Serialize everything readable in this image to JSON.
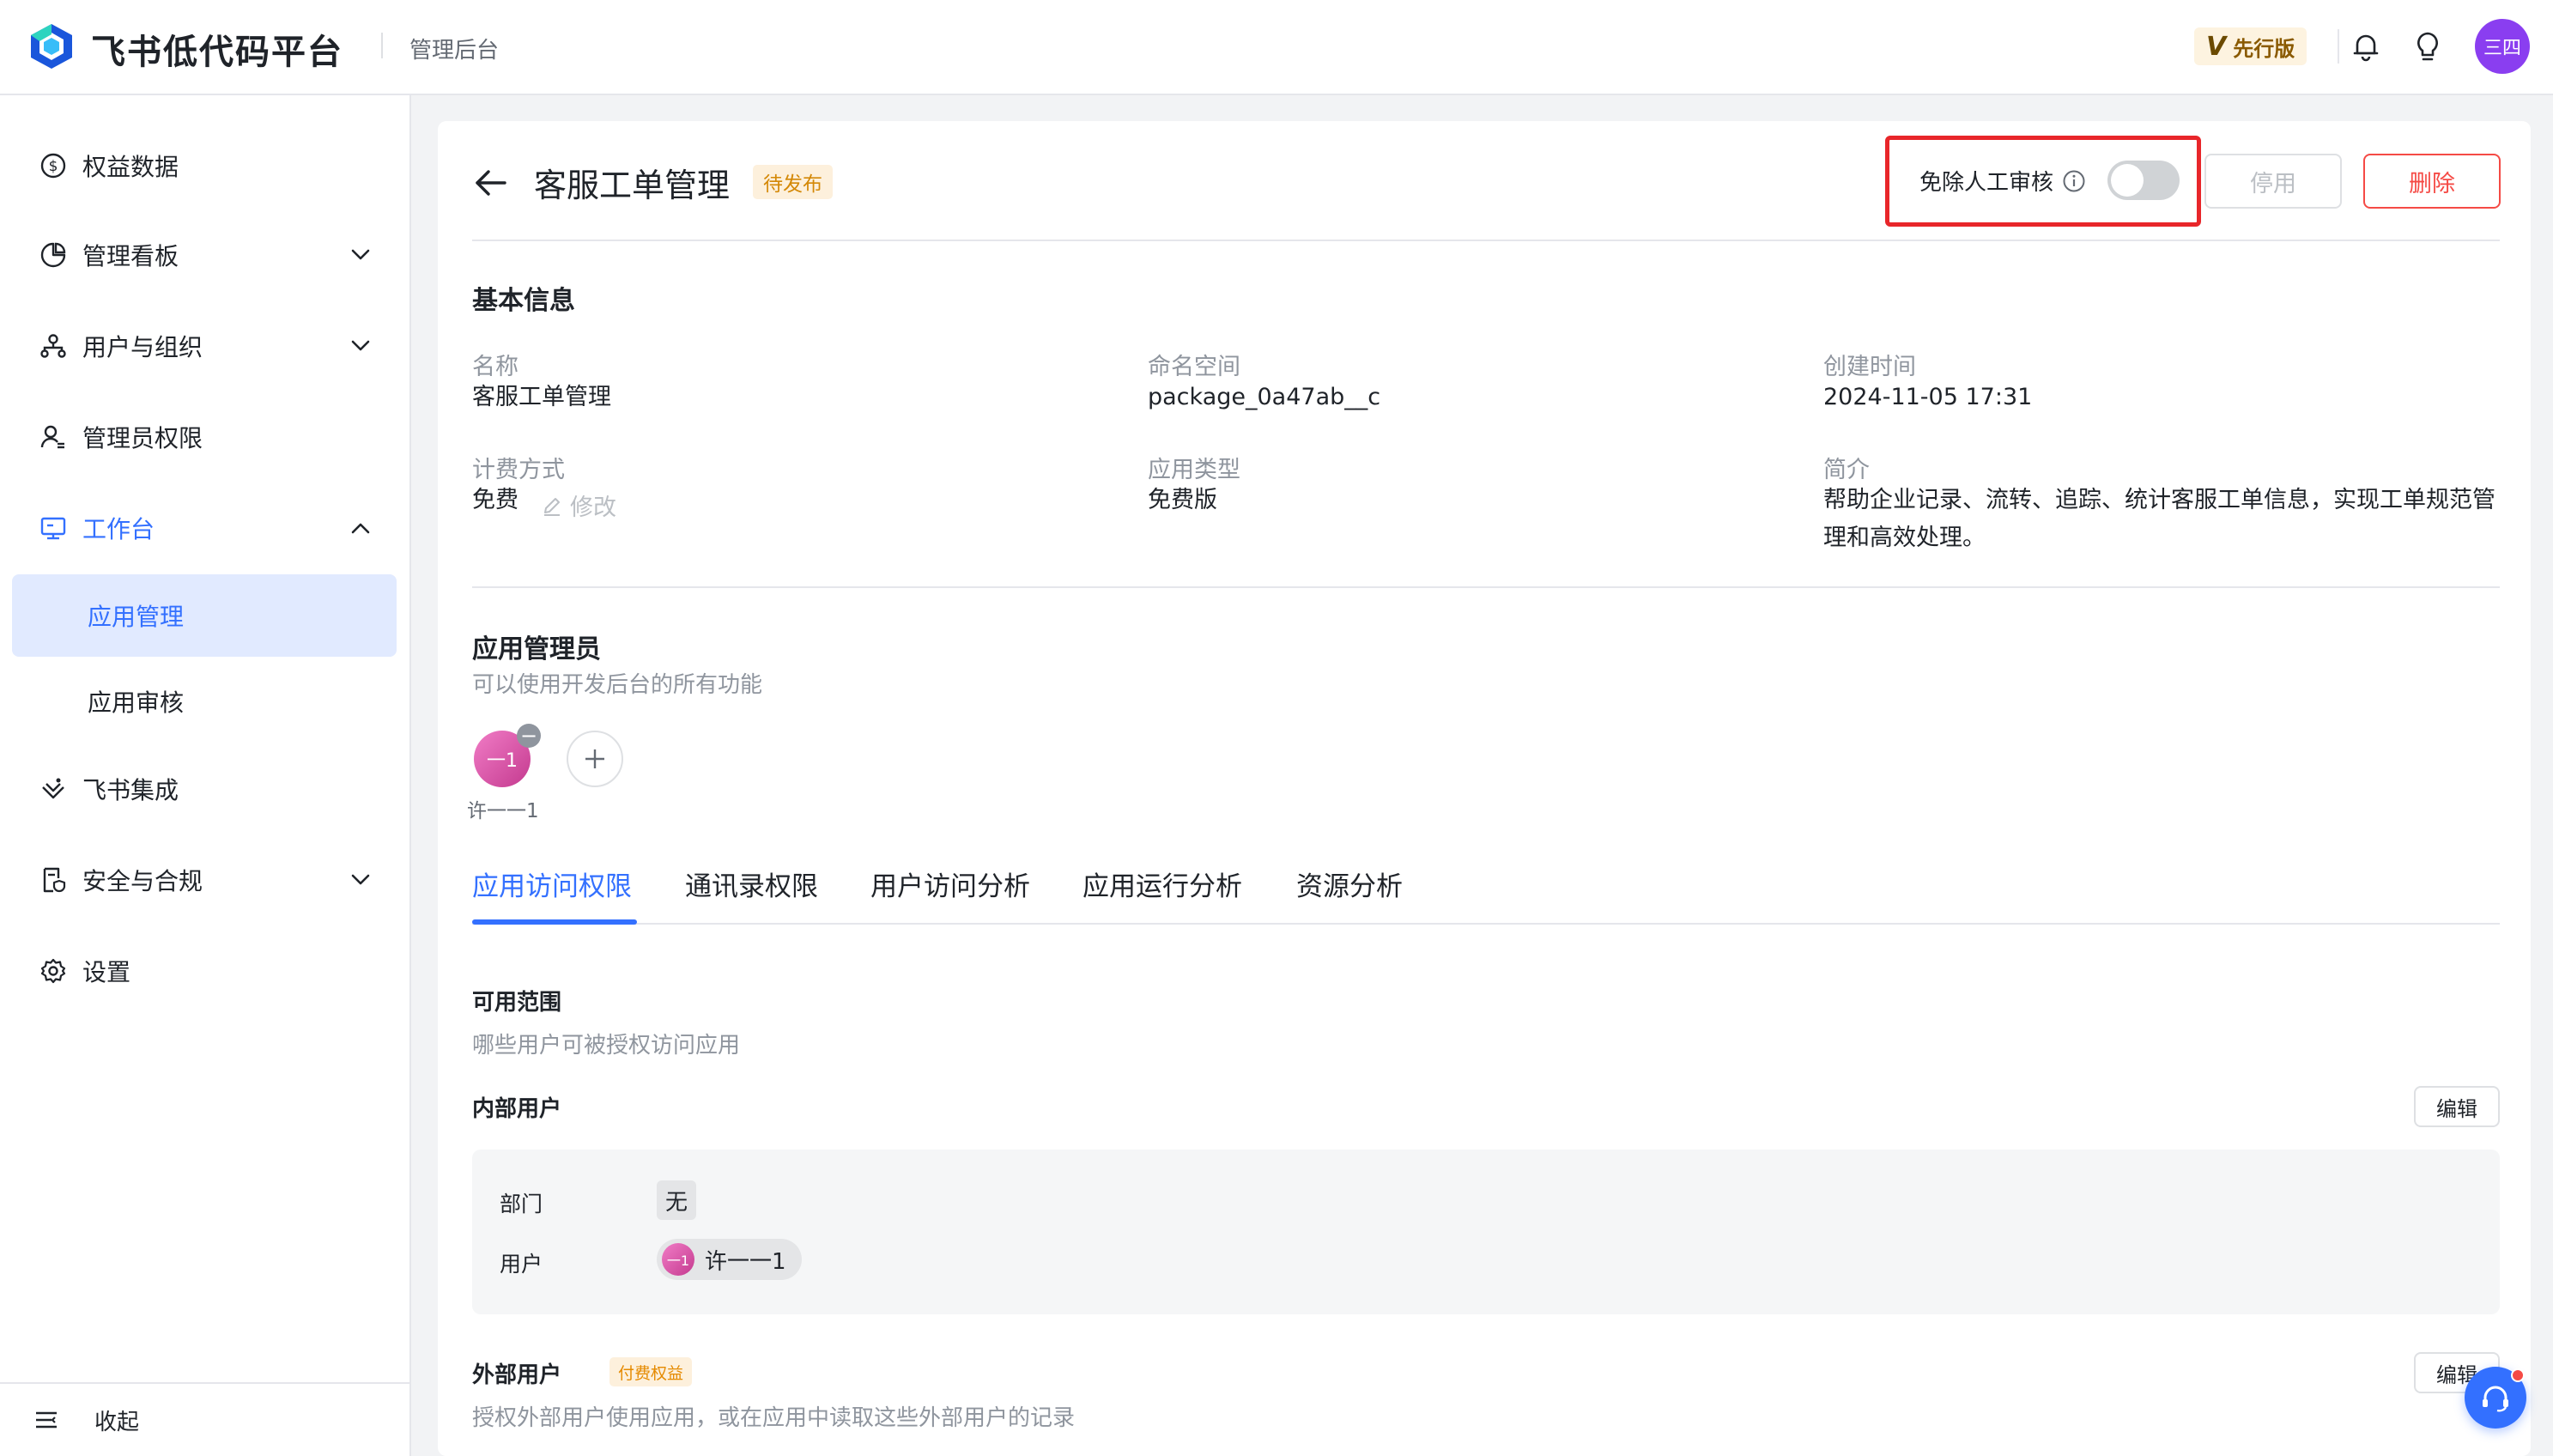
{
  "header": {
    "brand": "飞书低代码平台",
    "subtitle": "管理后台",
    "edition_badge": "先行版",
    "edition_mark": "V",
    "user_avatar": "三四"
  },
  "sidebar": {
    "items": [
      {
        "label": "权益数据",
        "icon": "dollar-circle-icon"
      },
      {
        "label": "管理看板",
        "icon": "pie-chart-icon",
        "expandable": true
      },
      {
        "label": "用户与组织",
        "icon": "org-chart-icon",
        "expandable": true
      },
      {
        "label": "管理员权限",
        "icon": "admin-user-icon"
      },
      {
        "label": "工作台",
        "icon": "monitor-icon",
        "expanded": true,
        "active": true
      },
      {
        "label": "飞书集成",
        "icon": "integration-icon"
      },
      {
        "label": "安全与合规",
        "icon": "shield-doc-icon",
        "expandable": true
      },
      {
        "label": "设置",
        "icon": "gear-icon"
      }
    ],
    "sub_items": [
      {
        "label": "应用管理",
        "selected": true
      },
      {
        "label": "应用审核",
        "selected": false
      }
    ],
    "collapse_label": "收起"
  },
  "page": {
    "title": "客服工单管理",
    "status": "待发布",
    "review_toggle_label": "免除人工审核",
    "review_toggle_on": false,
    "disable_button": "停用",
    "delete_button": "删除"
  },
  "basic_info": {
    "title": "基本信息",
    "name_label": "名称",
    "name_value": "客服工单管理",
    "namespace_label": "命名空间",
    "namespace_value": "package_0a47ab__c",
    "created_label": "创建时间",
    "created_value": "2024-11-05 17:31",
    "billing_label": "计费方式",
    "billing_value": "免费",
    "billing_edit": "修改",
    "type_label": "应用类型",
    "type_value": "免费版",
    "intro_label": "简介",
    "intro_value": "帮助企业记录、流转、追踪、统计客服工单信息，实现工单规范管理和高效处理。"
  },
  "admins": {
    "title": "应用管理员",
    "hint": "可以使用开发后台的所有功能",
    "members": [
      {
        "name": "许一一1",
        "avatar_text": "一1"
      }
    ]
  },
  "tabs": [
    "应用访问权限",
    "通讯录权限",
    "用户访问分析",
    "应用运行分析",
    "资源分析"
  ],
  "access": {
    "scope_title": "可用范围",
    "scope_hint": "哪些用户可被授权访问应用",
    "internal_title": "内部用户",
    "edit_button": "编辑",
    "department_label": "部门",
    "department_value": "无",
    "user_label": "用户",
    "user_value": "许一一1",
    "user_avatar_text": "一1",
    "external_title": "外部用户",
    "external_badge": "付费权益",
    "external_hint": "授权外部用户使用应用，或在应用中读取这些外部用户的记录",
    "external_edit": "编辑"
  },
  "colors": {
    "accent": "#3370ff",
    "danger": "#f54a45",
    "warning": "#d48806",
    "highlight": "#e8262a"
  }
}
